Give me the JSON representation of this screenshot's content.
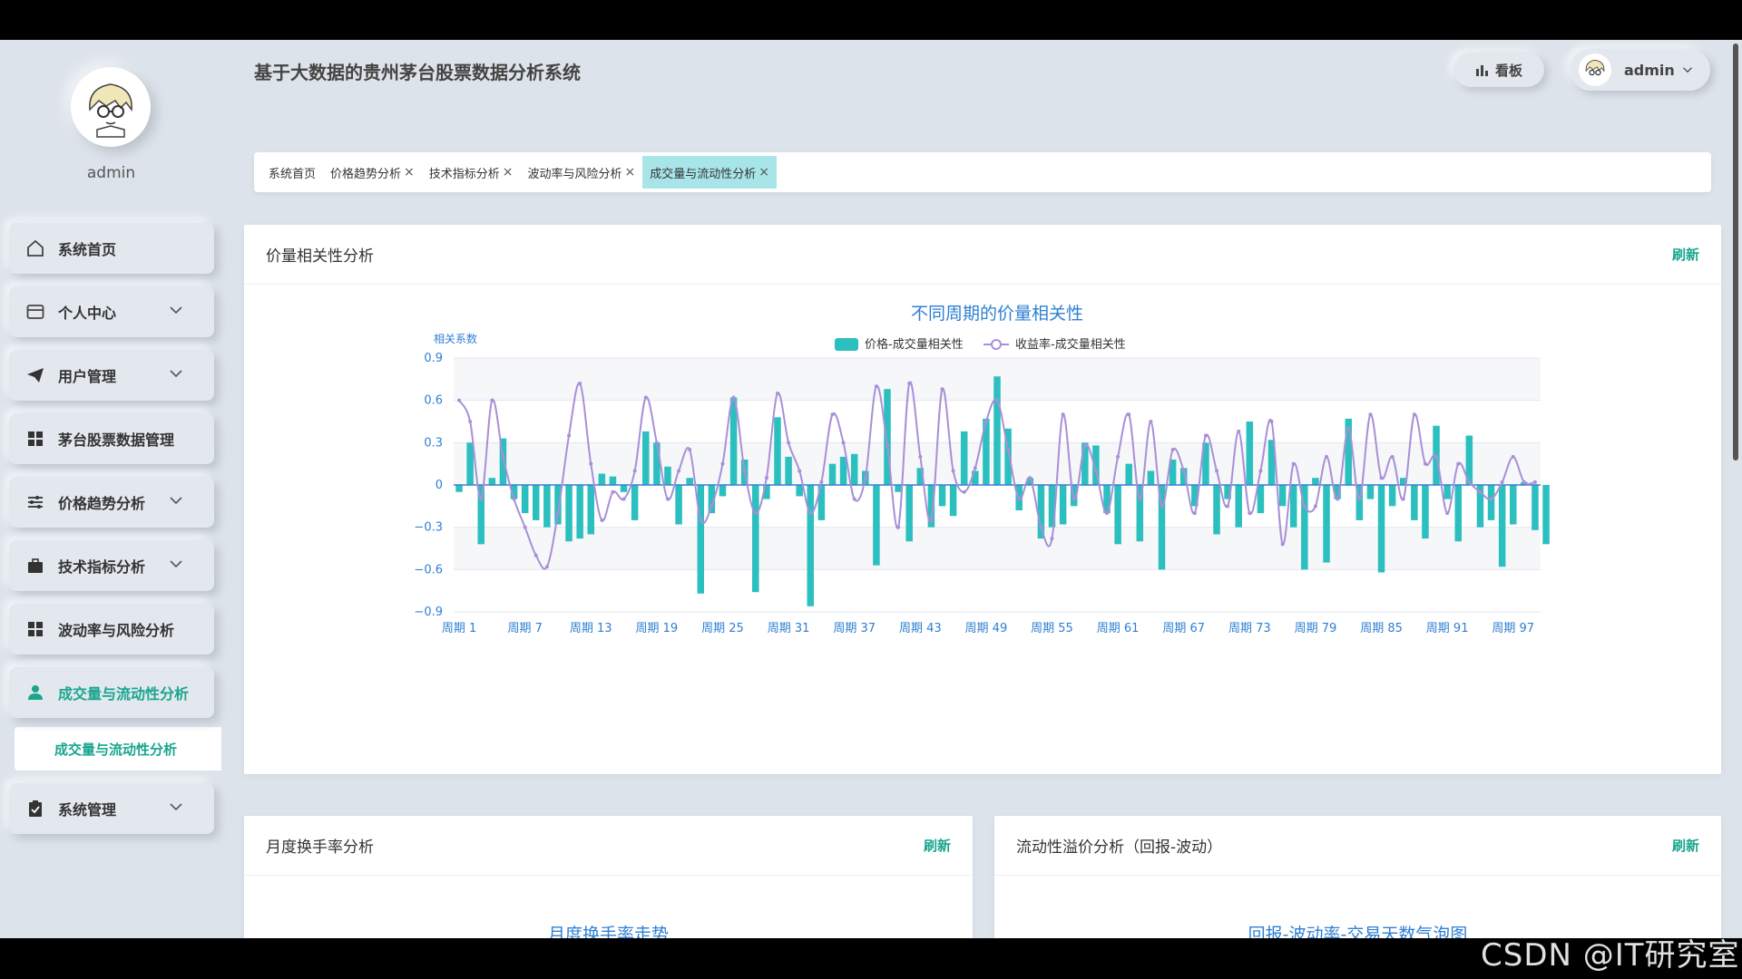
{
  "app": {
    "title": "基于大数据的贵州茅台股票数据分析系统",
    "user": "admin"
  },
  "header": {
    "board_label": "看板",
    "user_label": "admin"
  },
  "sidebar": {
    "username": "admin",
    "items": [
      {
        "label": "系统首页",
        "icon": "home-icon"
      },
      {
        "label": "个人中心",
        "icon": "card-icon",
        "has_children": true
      },
      {
        "label": "用户管理",
        "icon": "paper-plane-icon",
        "has_children": true
      },
      {
        "label": "茅台股票数据管理",
        "icon": "grid-icon"
      },
      {
        "label": "价格趋势分析",
        "icon": "sliders-icon",
        "has_children": true
      },
      {
        "label": "技术指标分析",
        "icon": "briefcase-icon",
        "has_children": true
      },
      {
        "label": "波动率与风险分析",
        "icon": "grid-icon"
      },
      {
        "label": "成交量与流动性分析",
        "icon": "user-icon",
        "active": true
      },
      {
        "label": "系统管理",
        "icon": "clipboard-icon",
        "has_children": true
      }
    ],
    "submenu_active": "成交量与流动性分析"
  },
  "tabs": [
    {
      "label": "系统首页",
      "closable": false
    },
    {
      "label": "价格趋势分析",
      "closable": true
    },
    {
      "label": "技术指标分析",
      "closable": true
    },
    {
      "label": "波动率与风险分析",
      "closable": true
    },
    {
      "label": "成交量与流动性分析",
      "closable": true,
      "active": true
    }
  ],
  "tab_close_glyph": "×",
  "main_card": {
    "title": "价量相关性分析",
    "refresh": "刷新"
  },
  "card_bottom_left": {
    "title": "月度换手率分析",
    "refresh": "刷新",
    "chart_title": "月度换手率走势"
  },
  "card_bottom_right": {
    "title": "流动性溢价分析（回报-波动）",
    "refresh": "刷新",
    "chart_title": "回报-波动率-交易天数气泡图"
  },
  "colors": {
    "accent": "#1aa58f",
    "bar": "#2bbfbf",
    "line": "#a98fd8",
    "title_blue": "#2e7fd4"
  },
  "watermark": "CSDN @IT研究室",
  "chart_data": {
    "type": "bar",
    "title": "不同周期的价量相关性",
    "ylabel": "相关系数",
    "ylim": [
      -0.9,
      0.9
    ],
    "yticks": [
      "0.9",
      "0.6",
      "0.3",
      "0",
      "−0.3",
      "−0.6",
      "−0.9"
    ],
    "ytick_values": [
      0.9,
      0.6,
      0.3,
      0,
      -0.3,
      -0.6,
      -0.9
    ],
    "xtick_labels": [
      "周期 1",
      "周期 7",
      "周期 13",
      "周期 19",
      "周期 25",
      "周期 31",
      "周期 37",
      "周期 43",
      "周期 49",
      "周期 55",
      "周期 61",
      "周期 67",
      "周期 73",
      "周期 79",
      "周期 85",
      "周期 91",
      "周期 97"
    ],
    "xtick_step": 6,
    "n": 99,
    "legend_position": "top",
    "series": [
      {
        "name": "价格-成交量相关性",
        "type": "bar",
        "values": [
          -0.05,
          0.3,
          -0.42,
          0.05,
          0.33,
          -0.1,
          -0.2,
          -0.25,
          -0.3,
          -0.28,
          -0.4,
          -0.38,
          -0.35,
          0.08,
          0.06,
          -0.05,
          -0.25,
          0.38,
          0.3,
          0.13,
          -0.28,
          0.05,
          -0.77,
          -0.2,
          -0.08,
          0.62,
          0.18,
          -0.76,
          -0.1,
          0.48,
          0.2,
          -0.08,
          -0.86,
          -0.25,
          0.15,
          0.2,
          0.22,
          0.1,
          -0.57,
          0.68,
          -0.05,
          -0.4,
          0.12,
          -0.3,
          -0.15,
          -0.22,
          0.38,
          0.1,
          0.47,
          0.77,
          0.4,
          -0.18,
          0.05,
          -0.38,
          -0.3,
          -0.28,
          -0.15,
          0.3,
          0.28,
          -0.2,
          -0.42,
          0.15,
          -0.4,
          0.1,
          -0.6,
          0.18,
          0.12,
          -0.15,
          0.3,
          -0.35,
          -0.1,
          -0.3,
          0.45,
          -0.2,
          0.32,
          -0.15,
          -0.3,
          -0.6,
          0.05,
          -0.55,
          -0.1,
          0.47,
          -0.25,
          -0.1,
          -0.62,
          -0.15,
          0.05,
          -0.25,
          -0.38,
          0.42,
          -0.1,
          -0.4,
          0.35,
          -0.3,
          -0.25,
          -0.58,
          -0.28,
          0.02,
          -0.32,
          -0.42
        ],
        "color": "#2bbfbf"
      },
      {
        "name": "收益率-成交量相关性",
        "type": "line",
        "values": [
          0.6,
          0.45,
          -0.1,
          0.6,
          0.2,
          -0.1,
          -0.3,
          -0.5,
          -0.58,
          -0.2,
          0.35,
          0.72,
          0.15,
          -0.25,
          -0.05,
          -0.1,
          0.1,
          0.62,
          0.3,
          -0.1,
          0.1,
          0.25,
          -0.25,
          -0.15,
          0.15,
          0.62,
          0.1,
          -0.2,
          0.05,
          0.65,
          0.3,
          0.1,
          -0.2,
          0.02,
          0.5,
          0.3,
          -0.1,
          0.05,
          0.7,
          0.28,
          -0.3,
          0.72,
          0.2,
          -0.25,
          0.68,
          0.1,
          -0.05,
          0.12,
          0.45,
          0.6,
          0.25,
          -0.1,
          0.05,
          -0.3,
          -0.38,
          0.5,
          -0.1,
          0.28,
          0.1,
          -0.2,
          0.2,
          0.5,
          -0.1,
          0.45,
          -0.15,
          0.25,
          0.1,
          -0.2,
          0.35,
          0.1,
          -0.15,
          0.38,
          -0.2,
          0.1,
          0.45,
          -0.42,
          0.15,
          -0.15,
          -0.15,
          0.2,
          -0.1,
          0.4,
          -0.1,
          0.5,
          0.05,
          0.2,
          -0.1,
          0.5,
          0.15,
          0.2,
          -0.2,
          0.15,
          0.02,
          -0.05,
          -0.1,
          0.02,
          0.2,
          0.02,
          0.02
        ],
        "color": "#a98fd8"
      }
    ]
  }
}
